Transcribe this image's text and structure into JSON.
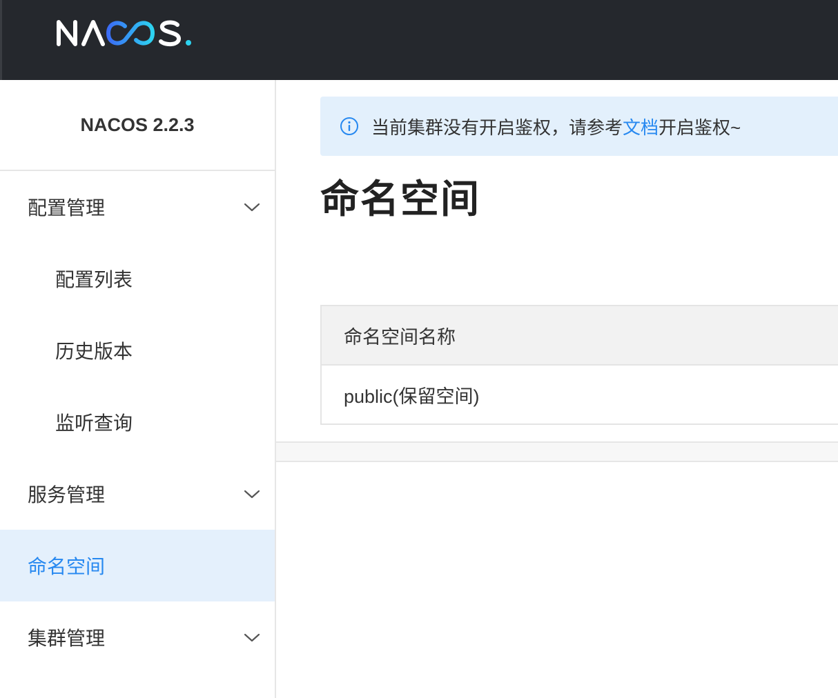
{
  "header": {
    "logo_text": "NACOS."
  },
  "sidebar": {
    "title": "NACOS 2.2.3",
    "menu": {
      "config_group": "配置管理",
      "config_list": "配置列表",
      "history": "历史版本",
      "listener_query": "监听查询",
      "service_group": "服务管理",
      "namespace": "命名空间",
      "cluster_group": "集群管理"
    }
  },
  "notice": {
    "text_before": "当前集群没有开启鉴权，请参考",
    "link_text": "文档",
    "text_after": "开启鉴权~"
  },
  "page": {
    "title": "命名空间"
  },
  "table": {
    "header": "命名空间名称",
    "rows": [
      "public(保留空间)"
    ]
  },
  "colors": {
    "topbar": "#25282d",
    "accent": "#2688f0",
    "active_bg": "#e4f0fc",
    "notice_bg": "#e3f0fc"
  }
}
